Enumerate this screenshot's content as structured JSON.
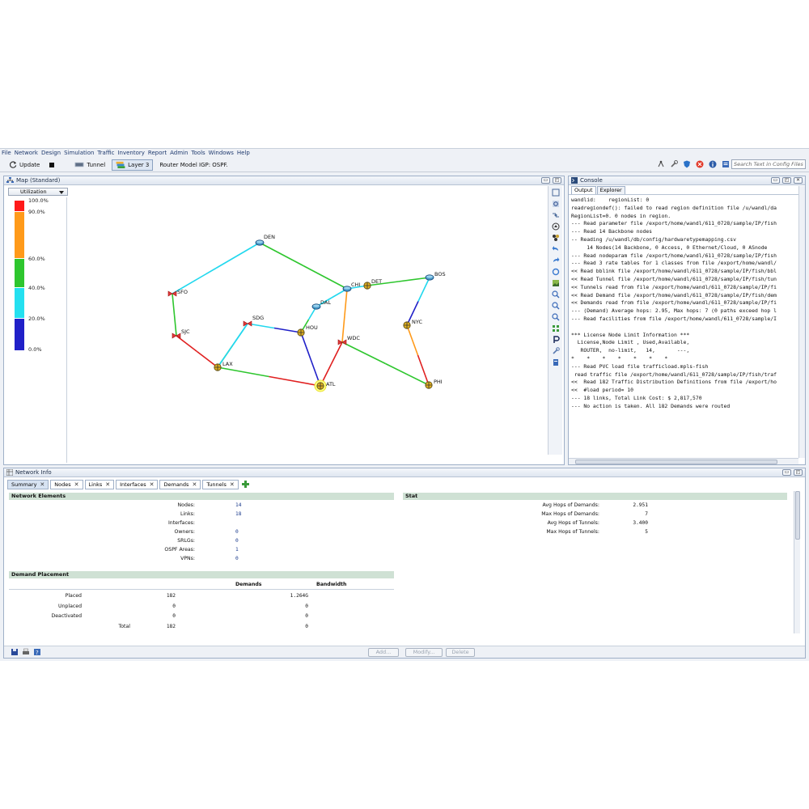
{
  "menu": [
    "File",
    "Network",
    "Design",
    "Simulation",
    "Traffic",
    "Inventory",
    "Report",
    "Admin",
    "Tools",
    "Windows",
    "Help"
  ],
  "toolbar": {
    "update_label": "Update",
    "tunnel_label": "Tunnel",
    "layer3_label": "Layer 3",
    "router_model_text": "Router Model  IGP: OSPF.",
    "search_placeholder": "Search Text in Config Files"
  },
  "map": {
    "title": "Map (Standard)",
    "utilization_label": "Utilization",
    "legend": [
      {
        "label": "100.0%",
        "color": "#ff1a1a"
      },
      {
        "label": "90.0%",
        "color": "#ff9a1a"
      },
      {
        "label": "60.0%",
        "color": "#2ec62e"
      },
      {
        "label": "40.0%",
        "color": "#24e0f0"
      },
      {
        "label": "20.0%",
        "color": "#2020c8"
      },
      {
        "label": "0.0%",
        "color": ""
      }
    ],
    "nodes": [
      {
        "id": "DEN",
        "label": "DEN",
        "type": "router"
      },
      {
        "id": "SFO",
        "label": "SFO",
        "type": "bowtie"
      },
      {
        "id": "SJC",
        "label": "SJC",
        "type": "bowtie"
      },
      {
        "id": "LAX",
        "label": "LAX",
        "type": "cross"
      },
      {
        "id": "SDG",
        "label": "SDG",
        "type": "bowtie"
      },
      {
        "id": "HOU",
        "label": "HOU",
        "type": "cross"
      },
      {
        "id": "DAL",
        "label": "DAL",
        "type": "router"
      },
      {
        "id": "CHI",
        "label": "CHI",
        "type": "router"
      },
      {
        "id": "DET",
        "label": "DET",
        "type": "cross"
      },
      {
        "id": "BOS",
        "label": "BOS",
        "type": "router"
      },
      {
        "id": "NYC",
        "label": "NYC",
        "type": "cross"
      },
      {
        "id": "WDC",
        "label": "WDC",
        "type": "bowtie"
      },
      {
        "id": "ATL",
        "label": "ATL",
        "type": "cross-highlight"
      },
      {
        "id": "PHI",
        "label": "PHI",
        "type": "cross"
      }
    ]
  },
  "console": {
    "title": "Console",
    "tabs": [
      "Output",
      "Explorer"
    ],
    "lines": [
      "wandlid:    regionList: 0",
      "readregiondef(): failed to read region definition file /u/wandl/da",
      "RegionList=0. 0 nodes in region.",
      "--- Read parameter file /export/home/wandl/611_0728/sample/IP/fish",
      "--- Read 14 Backbone nodes",
      "-- Reading /u/wandl/db/config/hardwaretypemapping.csv",
      "     14 Nodes(14 Backbone, 0 Access, 0 Ethernet/Cloud, 0 ASnode",
      "--- Read nodeparam file /export/home/wandl/611_0728/sample/IP/fish",
      "--- Read 3 rate tables for 1 classes from file /export/home/wandl/",
      "<< Read bblink file /export/home/wandl/611_0728/sample/IP/fish/bbl",
      "<< Read Tunnel file /export/home/wandl/611_0728/sample/IP/fish/tun",
      "<< Tunnels read from file /export/home/wandl/611_0728/sample/IP/fi",
      "<< Read Demand file /export/home/wandl/611_0728/sample/IP/fish/dem",
      "<< Demands read from file /export/home/wandl/611_0728/sample/IP/fi",
      "--- (Demand) Average hops: 2.95, Max hops: 7 (0 paths exceed hop l",
      "--- Read facilities from file /export/home/wandl/611_0728/sample/I",
      "",
      "*** License Node Limit Information ***",
      "  License,Node Limit , Used,Available,",
      "   ROUTER,  no-limit,   14,       ---,",
      "*    *    *    *    *    *    *",
      "--- Read PVC load file trafficload.mpls-fish",
      " read traffic file /export/home/wandl/611_0728/sample/IP/fish/traf",
      "<<  Read 182 Traffic Distribution Definitions from file /export/ho",
      "<<  #load period= 10",
      "--- 18 links, Total Link Cost: $ 2,817,570",
      "--- No action is taken. All 182 Demands were routed"
    ]
  },
  "network_info": {
    "title": "Network Info",
    "tabs": [
      "Summary",
      "Nodes",
      "Links",
      "Interfaces",
      "Demands",
      "Tunnels"
    ],
    "network_elements": {
      "header": "Network Elements",
      "rows": [
        {
          "label": "Nodes:",
          "value": "14"
        },
        {
          "label": "Links:",
          "value": "18"
        },
        {
          "label": "Interfaces:",
          "value": ""
        },
        {
          "label": "Owners:",
          "value": "0"
        },
        {
          "label": "SRLGs:",
          "value": "0"
        },
        {
          "label": "OSPF Areas:",
          "value": "1"
        },
        {
          "label": "VPNs:",
          "value": "0"
        }
      ]
    },
    "stat": {
      "header": "Stat",
      "rows": [
        {
          "label": "Avg Hops of Demands:",
          "value": "2.951"
        },
        {
          "label": "Max Hops of Demands:",
          "value": "7"
        },
        {
          "label": "Avg Hops of Tunnels:",
          "value": "3.400"
        },
        {
          "label": "Max Hops of Tunnels:",
          "value": "5"
        }
      ]
    },
    "demand_placement": {
      "header": "Demand Placement",
      "col_demands": "Demands",
      "col_bandwidth": "Bandwidth",
      "rows": [
        {
          "label": "Placed",
          "demands": "182",
          "bandwidth": "1.264G"
        },
        {
          "label": "Unplaced",
          "demands": "0",
          "bandwidth": "0"
        },
        {
          "label": "Deactivated",
          "demands": "0",
          "bandwidth": "0"
        },
        {
          "label": "Total",
          "demands": "182",
          "bandwidth": "0"
        }
      ]
    },
    "buttons": {
      "add": "Add...",
      "modify": "Modify...",
      "delete": "Delete"
    }
  }
}
